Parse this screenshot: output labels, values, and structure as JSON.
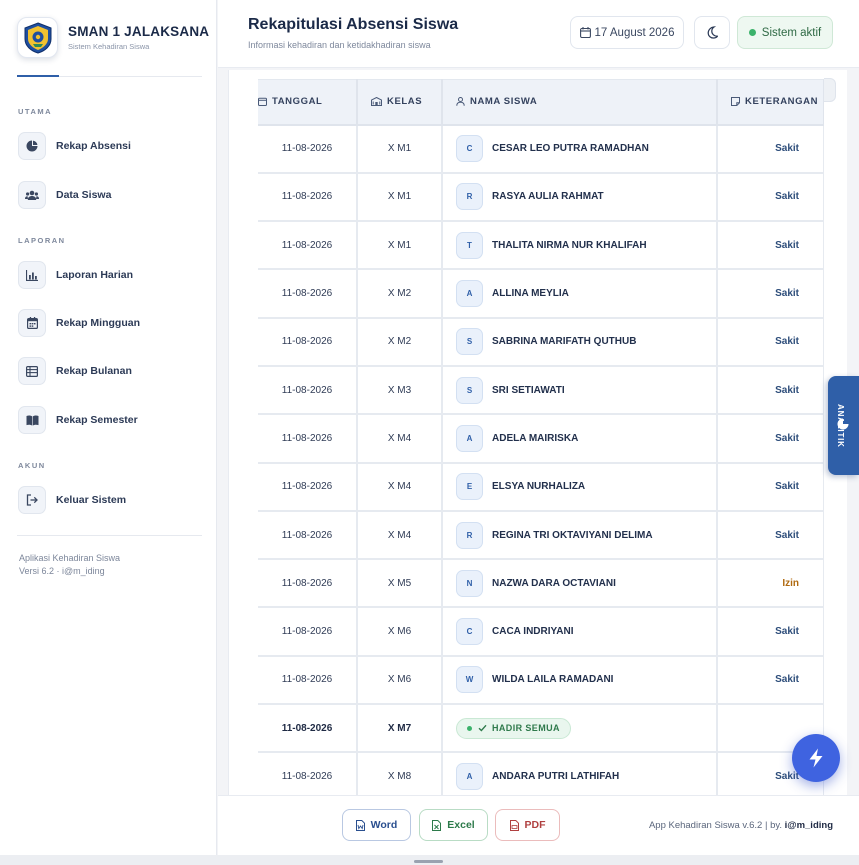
{
  "brand": {
    "name": "SMAN 1 JALAKSANA",
    "subtitle": "Sistem Kehadiran Siswa"
  },
  "sidebar": {
    "sections": [
      {
        "label": "UTAMA",
        "items": [
          {
            "label": "Rekap Absensi",
            "icon": "pie-chart-icon"
          },
          {
            "label": "Data Siswa",
            "icon": "users-icon"
          }
        ]
      },
      {
        "label": "LAPORAN",
        "items": [
          {
            "label": "Laporan Harian",
            "icon": "bar-chart-icon"
          },
          {
            "label": "Rekap Mingguan",
            "icon": "calendar-icon"
          },
          {
            "label": "Rekap Bulanan",
            "icon": "table-icon"
          },
          {
            "label": "Rekap Semester",
            "icon": "book-icon"
          }
        ]
      },
      {
        "label": "AKUN",
        "items": [
          {
            "label": "Keluar Sistem",
            "icon": "logout-icon"
          }
        ]
      }
    ],
    "footer_line1": "Aplikasi Kehadiran Siswa",
    "footer_line2": "Versi 6.2 · i@m_iding"
  },
  "header": {
    "title": "Rekapitulasi Absensi Siswa",
    "subtitle": "Informasi kehadiran dan ketidakhadiran siswa",
    "date": "17 August 2026",
    "status": "Sistem aktif"
  },
  "table": {
    "columns": [
      "TANGGAL",
      "KELAS",
      "NAMA SISWA",
      "KETERANGAN"
    ],
    "rows": [
      {
        "tanggal": "11-08-2026",
        "kelas": "X M1",
        "initial": "C",
        "nama": "CESAR LEO PUTRA RAMADHAN",
        "ket": "Sakit"
      },
      {
        "tanggal": "11-08-2026",
        "kelas": "X M1",
        "initial": "R",
        "nama": "RASYA AULIA RAHMAT",
        "ket": "Sakit"
      },
      {
        "tanggal": "11-08-2026",
        "kelas": "X M1",
        "initial": "T",
        "nama": "THALITA NIRMA NUR KHALIFAH",
        "ket": "Sakit"
      },
      {
        "tanggal": "11-08-2026",
        "kelas": "X M2",
        "initial": "A",
        "nama": "ALLINA MEYLIA",
        "ket": "Sakit"
      },
      {
        "tanggal": "11-08-2026",
        "kelas": "X M2",
        "initial": "S",
        "nama": "SABRINA MARIFATH QUTHUB",
        "ket": "Sakit"
      },
      {
        "tanggal": "11-08-2026",
        "kelas": "X M3",
        "initial": "S",
        "nama": "SRI SETIAWATI",
        "ket": "Sakit"
      },
      {
        "tanggal": "11-08-2026",
        "kelas": "X M4",
        "initial": "A",
        "nama": "ADELA MAIRISKA",
        "ket": "Sakit"
      },
      {
        "tanggal": "11-08-2026",
        "kelas": "X M4",
        "initial": "E",
        "nama": "ELSYA NURHALIZA",
        "ket": "Sakit"
      },
      {
        "tanggal": "11-08-2026",
        "kelas": "X M4",
        "initial": "R",
        "nama": "REGINA TRI OKTAVIYANI DELIMA",
        "ket": "Sakit"
      },
      {
        "tanggal": "11-08-2026",
        "kelas": "X M5",
        "initial": "N",
        "nama": "NAZWA DARA OCTAVIANI",
        "ket": "Izin"
      },
      {
        "tanggal": "11-08-2026",
        "kelas": "X M6",
        "initial": "C",
        "nama": "CACA INDRIYANI",
        "ket": "Sakit"
      },
      {
        "tanggal": "11-08-2026",
        "kelas": "X M6",
        "initial": "W",
        "nama": "WILDA LAILA RAMADANI",
        "ket": "Sakit"
      },
      {
        "tanggal": "11-08-2026",
        "kelas": "X M7",
        "hadir_semua": "HADIR SEMUA",
        "ket": ""
      },
      {
        "tanggal": "11-08-2026",
        "kelas": "X M8",
        "initial": "A",
        "nama": "ANDARA PUTRI LATHIFAH",
        "ket": "Sakit"
      }
    ]
  },
  "side_tab": {
    "label": "ANALITIK"
  },
  "footer": {
    "buttons": {
      "word": "Word",
      "excel": "Excel",
      "pdf": "PDF"
    },
    "credit_prefix": "App Kehadiran Siswa v.6.2 | by. ",
    "credit_author": "i@m_iding"
  },
  "colors": {
    "accent": "#2f5fa8",
    "fab": "#3f63e0",
    "success": "#3bb26b",
    "izin": "#b06a10"
  }
}
